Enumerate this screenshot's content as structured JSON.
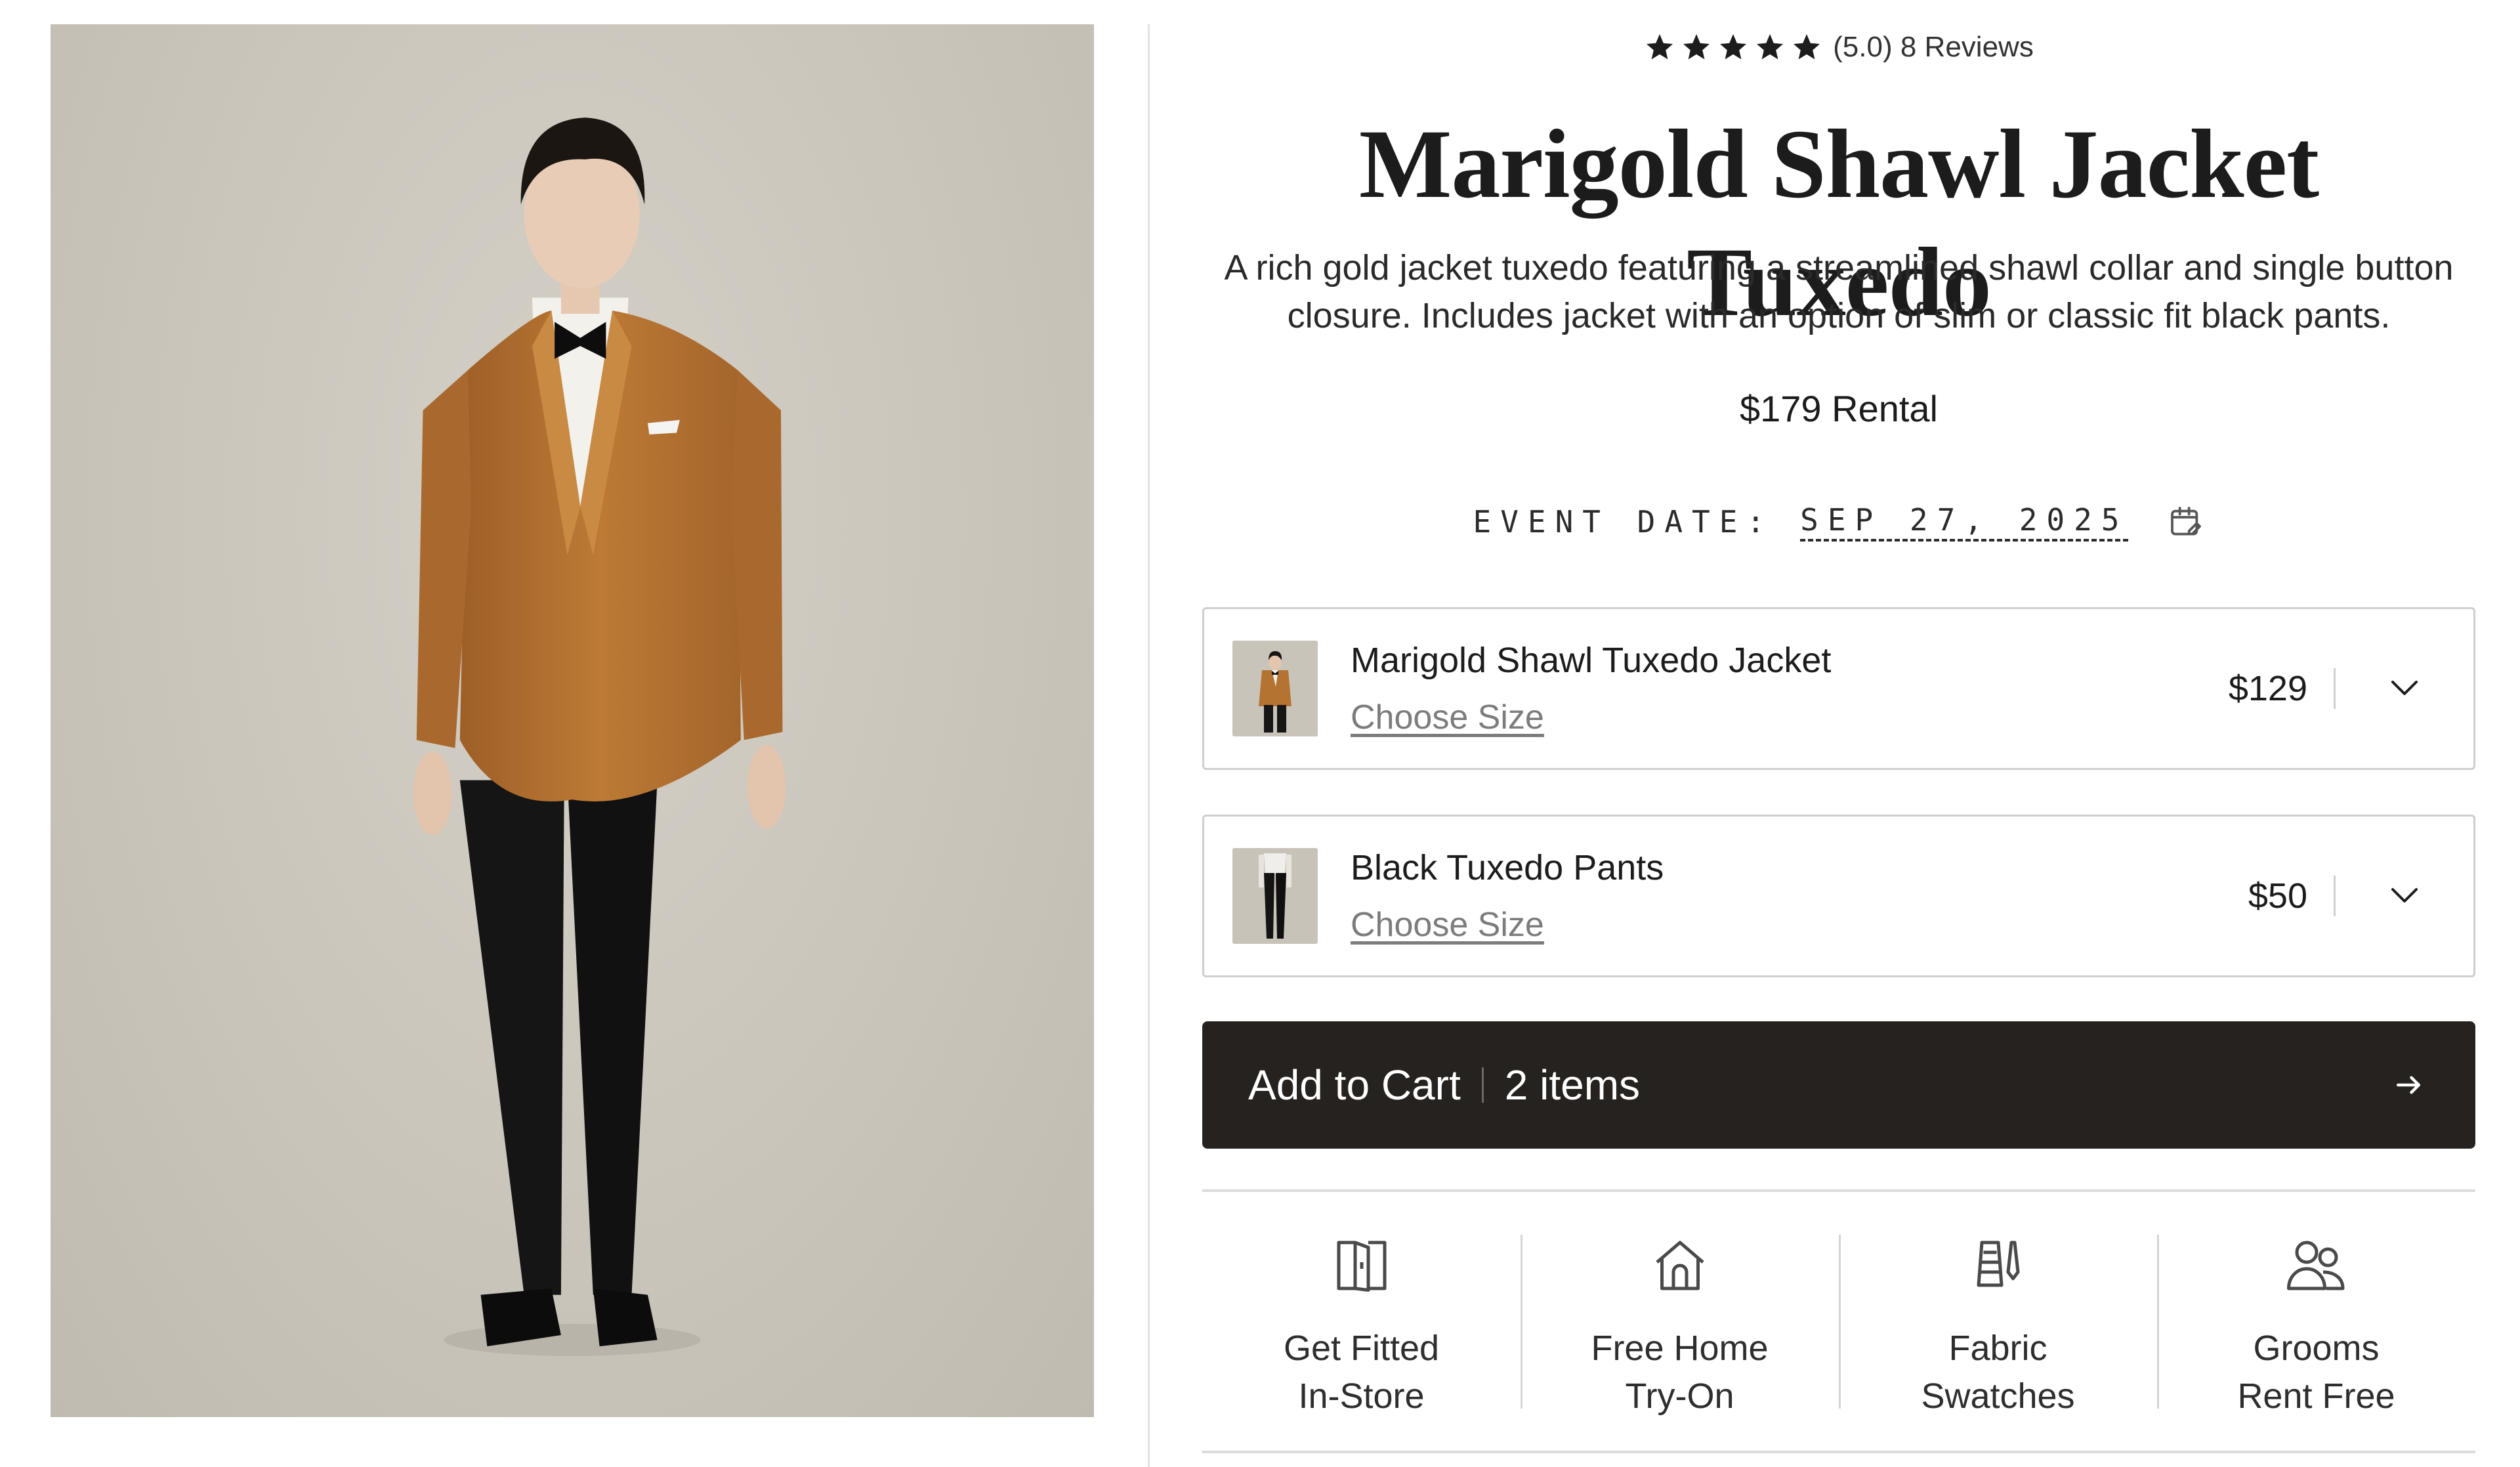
{
  "product": {
    "rating_value": 5.0,
    "rating_text": "(5.0) 8 Reviews",
    "title": "Marigold Shawl Jacket Tuxedo",
    "description": "A rich gold jacket tuxedo featuring a streamlined shawl collar and single button closure. Includes jacket with an option of slim or classic fit black pants.",
    "price": "$179 Rental"
  },
  "event": {
    "label": "EVENT DATE:",
    "date": "SEP 27, 2025",
    "icon": "calendar-edit-icon"
  },
  "items": [
    {
      "name": "Marigold Shawl Tuxedo Jacket",
      "size_link": "Choose Size",
      "price": "$129",
      "thumb": "jacket-thumbnail"
    },
    {
      "name": "Black Tuxedo Pants",
      "size_link": "Choose Size",
      "price": "$50",
      "thumb": "pants-thumbnail"
    }
  ],
  "cart": {
    "label": "Add to Cart",
    "count": "2 items",
    "icon": "arrow-right-icon"
  },
  "features": [
    {
      "label": "Get Fitted\nIn-Store",
      "icon": "fitting-room-icon"
    },
    {
      "label": "Free Home\nTry-On",
      "icon": "home-icon"
    },
    {
      "label": "Fabric\nSwatches",
      "icon": "fabric-swatch-icon"
    },
    {
      "label": "Grooms\nRent Free",
      "icon": "people-icon"
    }
  ],
  "colors": {
    "jacket": "#b57332",
    "button_bg": "#252220",
    "text": "#1c1c1c",
    "muted": "#7c7c7c",
    "border": "#cfcfcf"
  }
}
